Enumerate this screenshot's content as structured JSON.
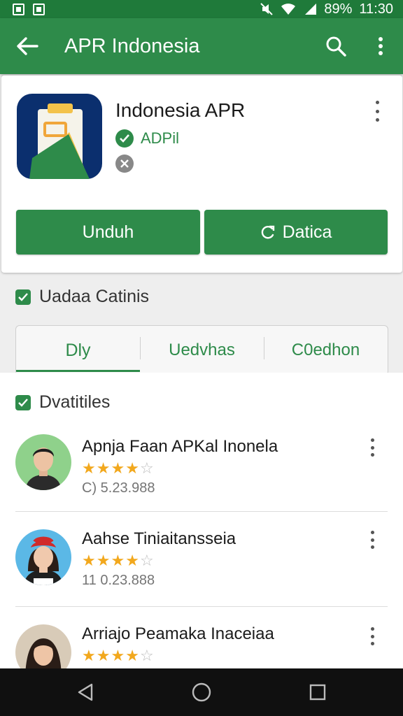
{
  "status_bar": {
    "time": "11:30",
    "battery": "89%"
  },
  "app_bar": {
    "title": "APR Indonesia"
  },
  "app": {
    "name": "Indonesia APR",
    "developer": "ADPil",
    "buttons": {
      "download": "Unduh",
      "second": "Datica"
    }
  },
  "section1": {
    "title": "Uadaa Catinis",
    "tabs": [
      "Dly",
      "Uedvhas",
      "C0edhon"
    ]
  },
  "reviews": {
    "title": "Dvatitiles",
    "items": [
      {
        "name": "Apnja Faan APKal Inonela",
        "rating": 3.5,
        "date": "C) 5.23.988"
      },
      {
        "name": "Aahse Tiniaitansseia",
        "rating": 3.5,
        "date": "11 0.23.888"
      },
      {
        "name": "Arriajo Peamaka Inaceiaa",
        "rating": 3.5,
        "date": ""
      }
    ]
  },
  "colors": {
    "primary": "#2e8b4a",
    "status_bar": "#1f7a3a",
    "star": "#f2a81d"
  }
}
